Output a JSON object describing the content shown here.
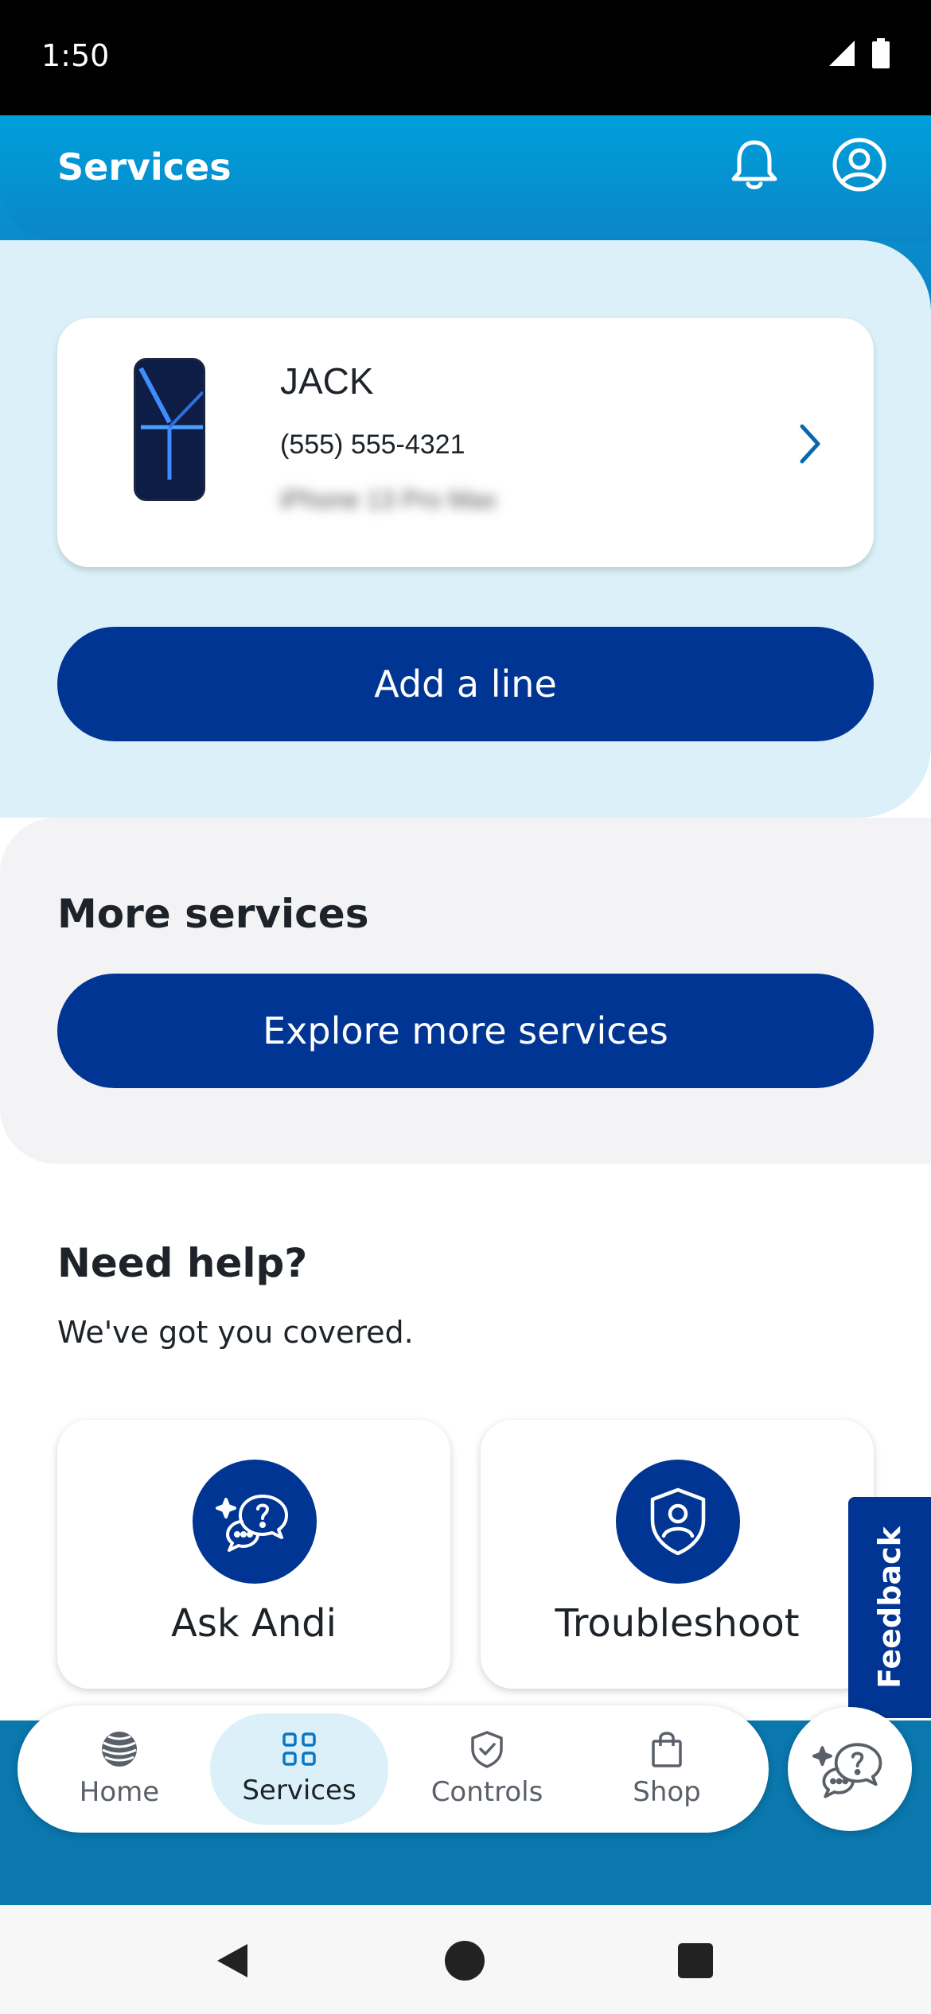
{
  "status_bar": {
    "time": "1:50"
  },
  "header": {
    "title": "Services"
  },
  "wireless": {
    "device": {
      "name": "JACK",
      "number": "(555) 555-4321",
      "model": "iPhone 13 Pro Max"
    },
    "add_line_label": "Add a line"
  },
  "more_services": {
    "heading": "More services",
    "button_label": "Explore more services"
  },
  "help": {
    "heading": "Need help?",
    "subtitle": "We've got you covered.",
    "cards": [
      {
        "label": "Ask Andi",
        "icon": "chat-question-icon"
      },
      {
        "label": "Troubleshoot",
        "icon": "shield-user-icon"
      }
    ]
  },
  "feedback": {
    "label": "Feedback"
  },
  "bottom_nav": {
    "items": [
      {
        "label": "Home",
        "icon": "att-globe-icon",
        "active": false
      },
      {
        "label": "Services",
        "icon": "grid-icon",
        "active": true
      },
      {
        "label": "Controls",
        "icon": "shield-check-icon",
        "active": false
      },
      {
        "label": "Shop",
        "icon": "shopping-bag-icon",
        "active": false
      }
    ]
  },
  "colors": {
    "header_blue": "#009fdb",
    "primary_button": "#003594",
    "wireless_bg": "#dbf0f8",
    "more_bg": "#f3f3f5"
  }
}
